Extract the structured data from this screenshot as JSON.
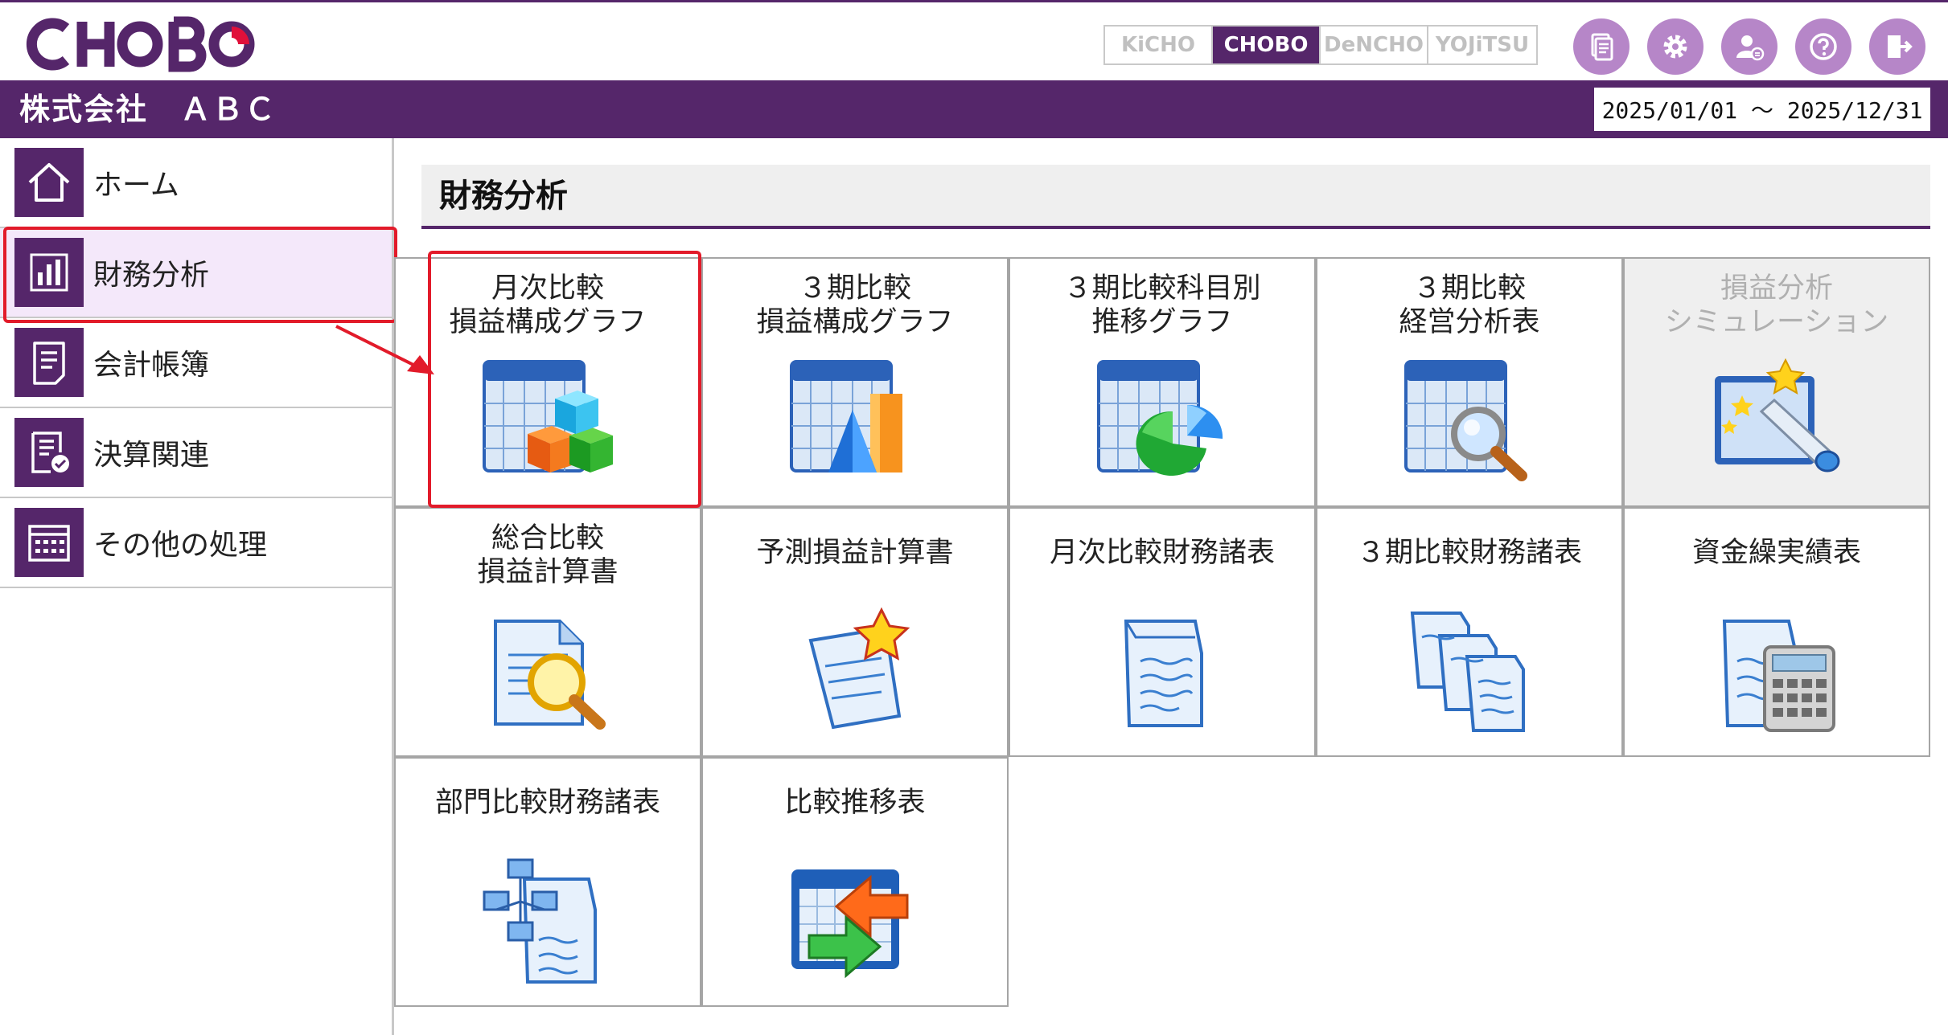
{
  "header": {
    "logo_text": "CHOBO",
    "systems": [
      {
        "label": "KiCHO",
        "active": false
      },
      {
        "label": "CHOBO",
        "active": true
      },
      {
        "label": "DeNCHO",
        "active": false
      },
      {
        "label": "YOJiTSU",
        "active": false
      }
    ],
    "icons": [
      "document-icon",
      "gear-icon",
      "user-settings-icon",
      "help-icon",
      "logout-icon"
    ]
  },
  "company": {
    "name": "株式会社　ＡＢＣ",
    "period": "2025/01/01 ～ 2025/12/31"
  },
  "sidebar": {
    "items": [
      {
        "label": "ホーム",
        "icon": "home-icon"
      },
      {
        "label": "財務分析",
        "icon": "bar-chart-icon",
        "selected": true
      },
      {
        "label": "会計帳簿",
        "icon": "ledger-icon"
      },
      {
        "label": "決算関連",
        "icon": "settlement-icon"
      },
      {
        "label": "その他の処理",
        "icon": "calendar-icon"
      }
    ]
  },
  "main": {
    "title": "財務分析",
    "tiles": [
      {
        "line1": "月次比較",
        "line2": "損益構成グラフ",
        "icon": "cubes-chart-icon"
      },
      {
        "line1": "３期比較",
        "line2": "損益構成グラフ",
        "icon": "bar-pyramid-chart-icon"
      },
      {
        "line1": "３期比較科目別",
        "line2": "推移グラフ",
        "icon": "pie-chart-icon"
      },
      {
        "line1": "３期比較",
        "line2": "経営分析表",
        "icon": "magnifier-chart-icon"
      },
      {
        "line1": "損益分析",
        "line2": "シミュレーション",
        "icon": "telescope-icon",
        "disabled": true
      },
      {
        "line1": "総合比較",
        "line2": "損益計算書",
        "icon": "document-search-icon"
      },
      {
        "line1": "予測損益計算書",
        "line2": "",
        "icon": "document-star-icon"
      },
      {
        "line1": "月次比較財務諸表",
        "line2": "",
        "icon": "document-icon"
      },
      {
        "line1": "３期比較財務諸表",
        "line2": "",
        "icon": "documents-stack-icon"
      },
      {
        "line1": "資金繰実績表",
        "line2": "",
        "icon": "document-calculator-icon"
      },
      {
        "line1": "部門比較財務諸表",
        "line2": "",
        "icon": "document-network-icon"
      },
      {
        "line1": "比較推移表",
        "line2": "",
        "icon": "arrows-chart-icon"
      }
    ]
  },
  "colors": {
    "brand_purple": "#55266a",
    "highlight_red": "#e21b2a",
    "selected_bg": "#f4e8fa",
    "disabled_bg": "#efefef"
  }
}
